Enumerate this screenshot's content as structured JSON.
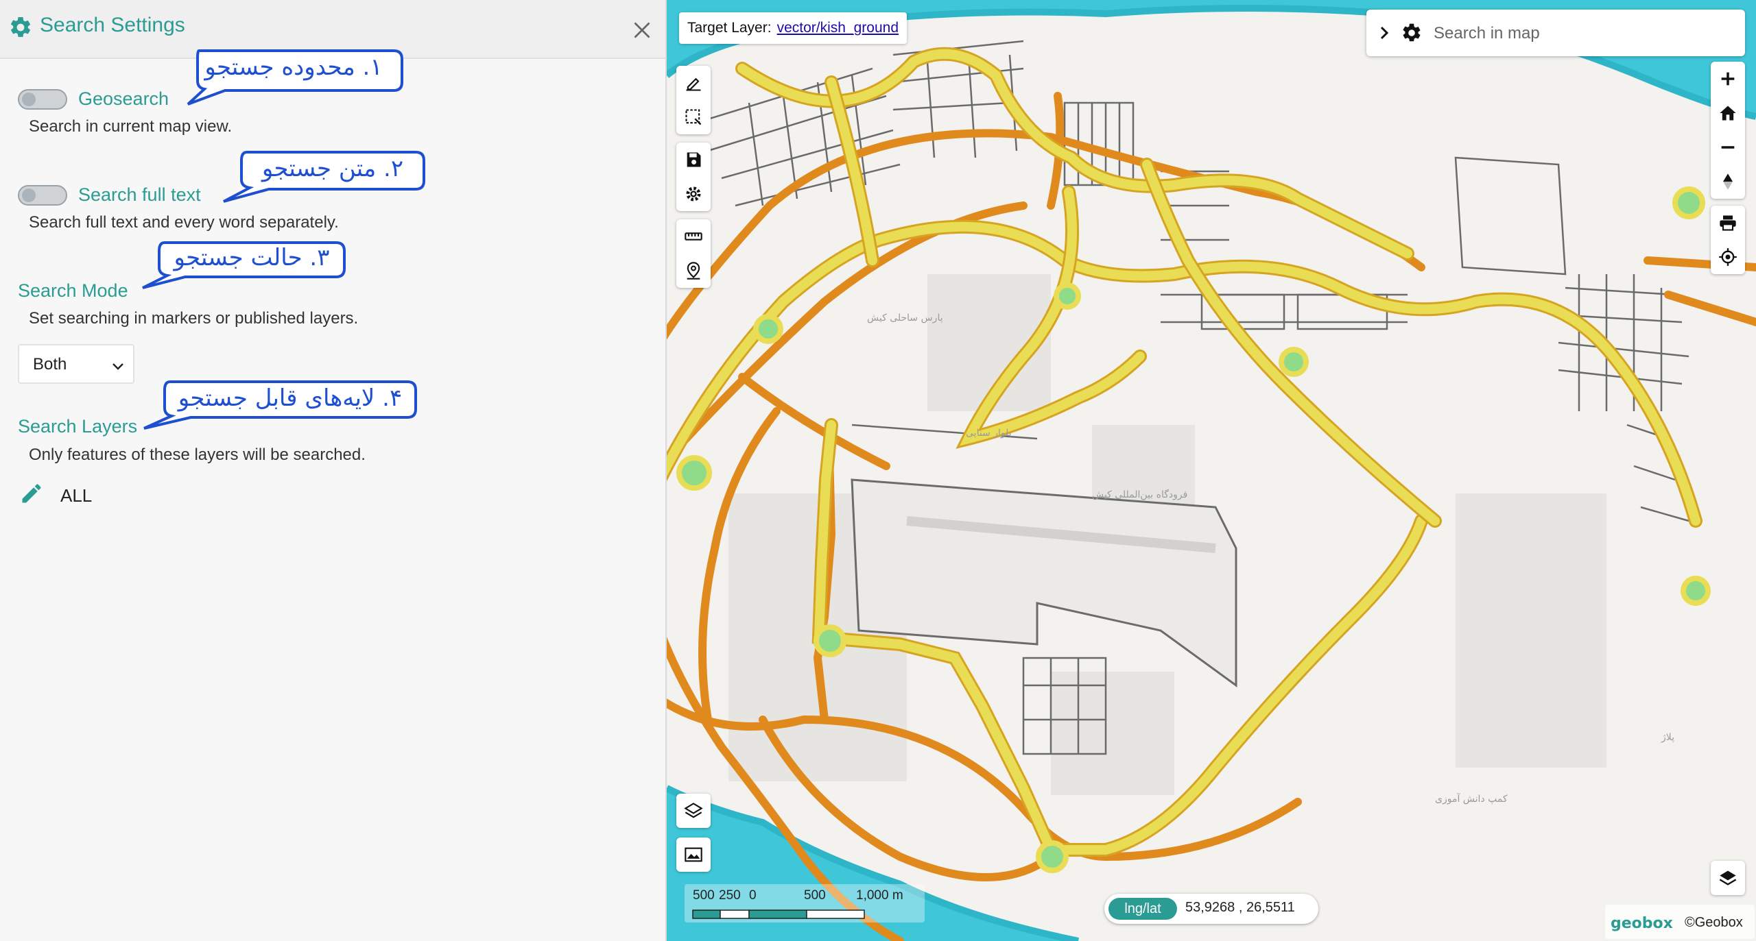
{
  "panel": {
    "title": "Search Settings",
    "settings": {
      "geosearch": {
        "label": "Geosearch",
        "description": "Search in current map view.",
        "enabled": false
      },
      "full_text": {
        "label": "Search full text",
        "description": "Search full text and every word separately.",
        "enabled": false
      },
      "mode": {
        "label": "Search Mode",
        "description": "Set searching in markers or published layers.",
        "value": "Both"
      },
      "layers": {
        "label": "Search Layers",
        "description": "Only features of these layers will be searched.",
        "value": "ALL"
      }
    },
    "callouts": [
      "۱. محدوده جستجو",
      "۲. متن جستجو",
      "۳. حالت جستجو",
      "۴. لایه‌های قابل جستجو"
    ]
  },
  "map": {
    "target_layer_label": "Target Layer:",
    "target_layer_value": "vector/kish_ground",
    "search_placeholder": "Search in map",
    "scale": {
      "labels": [
        "500",
        "250",
        "0",
        "500",
        "1,000 m"
      ]
    },
    "coords": {
      "label": "lng/lat",
      "value": "53,9268 , 26,5511"
    },
    "attribution": "©Geobox",
    "logo_text": "geobox",
    "place_labels": [
      "پارس ساحلی کیش",
      "بلوار سنایی",
      "فرودگاه بین‌المللی کیش",
      "کمپ دانش آموزی",
      "پلاژ"
    ],
    "left_tools": [
      "draw-icon",
      "select-area-icon",
      "save-icon",
      "settings-icon",
      "measure-icon",
      "marker-icon"
    ],
    "right_tools": [
      "zoom-in-icon",
      "home-icon",
      "zoom-out-icon",
      "north-arrow-icon",
      "print-icon",
      "locate-icon"
    ],
    "colors": {
      "accent": "#2a9c94",
      "sea": "#3fc7d9",
      "land": "#f3f2ef",
      "primary_road": "#e9dd55",
      "secondary_road": "#e08a1e",
      "callout": "#1d4fd0"
    }
  }
}
